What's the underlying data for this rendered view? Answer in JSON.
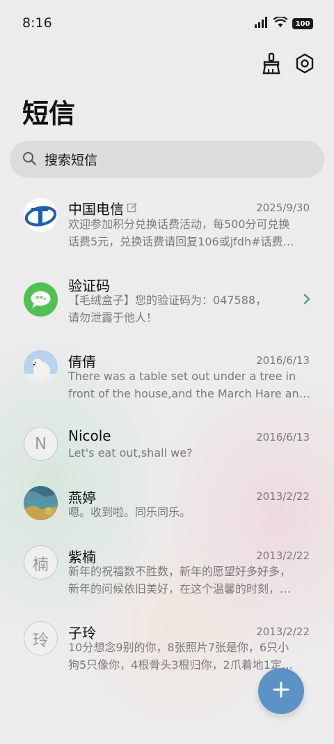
{
  "status_bar": {
    "time": "8:16",
    "battery": "100"
  },
  "header": {
    "title": "短信",
    "actions": [
      "broom-icon",
      "settings-icon"
    ]
  },
  "search": {
    "placeholder": "搜索短信"
  },
  "conversations": [
    {
      "name": "中国电信",
      "date": "2025/9/30",
      "lines": [
        "欢迎参加积分兑换话费活动，每500分可兑换",
        "话费5元，兑换话费请回复106或jfdh#话费…"
      ],
      "avatar": "china-telecom-logo",
      "has_edit_icon": true
    },
    {
      "name": "验证码",
      "date": "",
      "lines": [
        "【毛绒盒子】您的验证码为：047588，",
        "请勿泄露于他人！"
      ],
      "avatar": "message-bubble-icon",
      "has_chevron": true
    },
    {
      "name": "倩倩",
      "date": "2016/6/13",
      "lines": [
        "There was a table set out under a tree in",
        "front of the house,and the March Hare an…"
      ],
      "avatar": "polar-bear-photo"
    },
    {
      "name": "Nicole",
      "date": "2016/6/13",
      "lines": [
        "Let's eat out,shall we?"
      ],
      "avatar": "N"
    },
    {
      "name": "燕婷",
      "date": "2013/2/22",
      "lines": [
        "嗯。收到啦。同乐同乐。"
      ],
      "avatar": "landscape-photo"
    },
    {
      "name": "紫楠",
      "date": "2013/2/22",
      "lines": [
        "新年的祝福数不胜数，新年的愿望好多好多，",
        "新年的问候依旧美好，在这个温馨的时刻，…"
      ],
      "avatar": "楠"
    },
    {
      "name": "子玲",
      "date": "2013/2/22",
      "lines": [
        "10分想念9别的你，8张照片7张是你，6只小",
        "狗5只像你，4根骨头3根归你，2爪着地1定…"
      ],
      "avatar": "玲"
    }
  ],
  "fab": {
    "icon": "plus-icon"
  },
  "colors": {
    "accent": "#5b93c7",
    "telecom_blue": "#1b5fb8",
    "message_green": "#4fc352"
  }
}
